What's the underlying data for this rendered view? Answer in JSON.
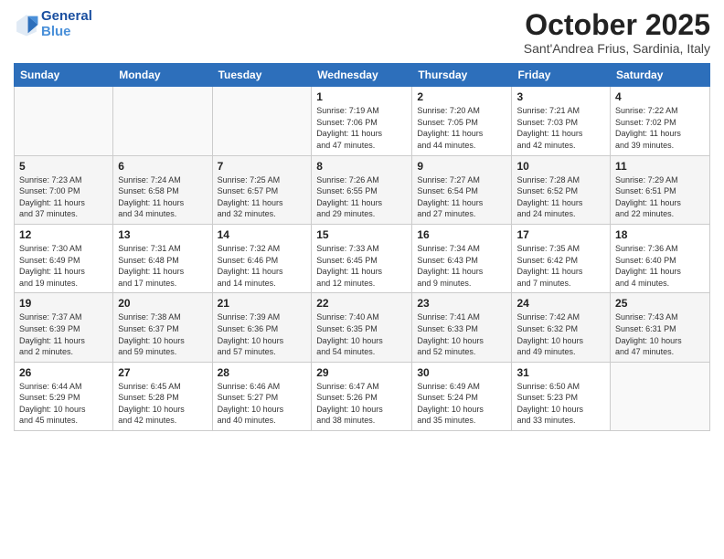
{
  "header": {
    "logo_line1": "General",
    "logo_line2": "Blue",
    "month_title": "October 2025",
    "location": "Sant'Andrea Frius, Sardinia, Italy"
  },
  "days_of_week": [
    "Sunday",
    "Monday",
    "Tuesday",
    "Wednesday",
    "Thursday",
    "Friday",
    "Saturday"
  ],
  "weeks": [
    [
      {
        "day": "",
        "info": ""
      },
      {
        "day": "",
        "info": ""
      },
      {
        "day": "",
        "info": ""
      },
      {
        "day": "1",
        "info": "Sunrise: 7:19 AM\nSunset: 7:06 PM\nDaylight: 11 hours\nand 47 minutes."
      },
      {
        "day": "2",
        "info": "Sunrise: 7:20 AM\nSunset: 7:05 PM\nDaylight: 11 hours\nand 44 minutes."
      },
      {
        "day": "3",
        "info": "Sunrise: 7:21 AM\nSunset: 7:03 PM\nDaylight: 11 hours\nand 42 minutes."
      },
      {
        "day": "4",
        "info": "Sunrise: 7:22 AM\nSunset: 7:02 PM\nDaylight: 11 hours\nand 39 minutes."
      }
    ],
    [
      {
        "day": "5",
        "info": "Sunrise: 7:23 AM\nSunset: 7:00 PM\nDaylight: 11 hours\nand 37 minutes."
      },
      {
        "day": "6",
        "info": "Sunrise: 7:24 AM\nSunset: 6:58 PM\nDaylight: 11 hours\nand 34 minutes."
      },
      {
        "day": "7",
        "info": "Sunrise: 7:25 AM\nSunset: 6:57 PM\nDaylight: 11 hours\nand 32 minutes."
      },
      {
        "day": "8",
        "info": "Sunrise: 7:26 AM\nSunset: 6:55 PM\nDaylight: 11 hours\nand 29 minutes."
      },
      {
        "day": "9",
        "info": "Sunrise: 7:27 AM\nSunset: 6:54 PM\nDaylight: 11 hours\nand 27 minutes."
      },
      {
        "day": "10",
        "info": "Sunrise: 7:28 AM\nSunset: 6:52 PM\nDaylight: 11 hours\nand 24 minutes."
      },
      {
        "day": "11",
        "info": "Sunrise: 7:29 AM\nSunset: 6:51 PM\nDaylight: 11 hours\nand 22 minutes."
      }
    ],
    [
      {
        "day": "12",
        "info": "Sunrise: 7:30 AM\nSunset: 6:49 PM\nDaylight: 11 hours\nand 19 minutes."
      },
      {
        "day": "13",
        "info": "Sunrise: 7:31 AM\nSunset: 6:48 PM\nDaylight: 11 hours\nand 17 minutes."
      },
      {
        "day": "14",
        "info": "Sunrise: 7:32 AM\nSunset: 6:46 PM\nDaylight: 11 hours\nand 14 minutes."
      },
      {
        "day": "15",
        "info": "Sunrise: 7:33 AM\nSunset: 6:45 PM\nDaylight: 11 hours\nand 12 minutes."
      },
      {
        "day": "16",
        "info": "Sunrise: 7:34 AM\nSunset: 6:43 PM\nDaylight: 11 hours\nand 9 minutes."
      },
      {
        "day": "17",
        "info": "Sunrise: 7:35 AM\nSunset: 6:42 PM\nDaylight: 11 hours\nand 7 minutes."
      },
      {
        "day": "18",
        "info": "Sunrise: 7:36 AM\nSunset: 6:40 PM\nDaylight: 11 hours\nand 4 minutes."
      }
    ],
    [
      {
        "day": "19",
        "info": "Sunrise: 7:37 AM\nSunset: 6:39 PM\nDaylight: 11 hours\nand 2 minutes."
      },
      {
        "day": "20",
        "info": "Sunrise: 7:38 AM\nSunset: 6:37 PM\nDaylight: 10 hours\nand 59 minutes."
      },
      {
        "day": "21",
        "info": "Sunrise: 7:39 AM\nSunset: 6:36 PM\nDaylight: 10 hours\nand 57 minutes."
      },
      {
        "day": "22",
        "info": "Sunrise: 7:40 AM\nSunset: 6:35 PM\nDaylight: 10 hours\nand 54 minutes."
      },
      {
        "day": "23",
        "info": "Sunrise: 7:41 AM\nSunset: 6:33 PM\nDaylight: 10 hours\nand 52 minutes."
      },
      {
        "day": "24",
        "info": "Sunrise: 7:42 AM\nSunset: 6:32 PM\nDaylight: 10 hours\nand 49 minutes."
      },
      {
        "day": "25",
        "info": "Sunrise: 7:43 AM\nSunset: 6:31 PM\nDaylight: 10 hours\nand 47 minutes."
      }
    ],
    [
      {
        "day": "26",
        "info": "Sunrise: 6:44 AM\nSunset: 5:29 PM\nDaylight: 10 hours\nand 45 minutes."
      },
      {
        "day": "27",
        "info": "Sunrise: 6:45 AM\nSunset: 5:28 PM\nDaylight: 10 hours\nand 42 minutes."
      },
      {
        "day": "28",
        "info": "Sunrise: 6:46 AM\nSunset: 5:27 PM\nDaylight: 10 hours\nand 40 minutes."
      },
      {
        "day": "29",
        "info": "Sunrise: 6:47 AM\nSunset: 5:26 PM\nDaylight: 10 hours\nand 38 minutes."
      },
      {
        "day": "30",
        "info": "Sunrise: 6:49 AM\nSunset: 5:24 PM\nDaylight: 10 hours\nand 35 minutes."
      },
      {
        "day": "31",
        "info": "Sunrise: 6:50 AM\nSunset: 5:23 PM\nDaylight: 10 hours\nand 33 minutes."
      },
      {
        "day": "",
        "info": ""
      }
    ]
  ]
}
